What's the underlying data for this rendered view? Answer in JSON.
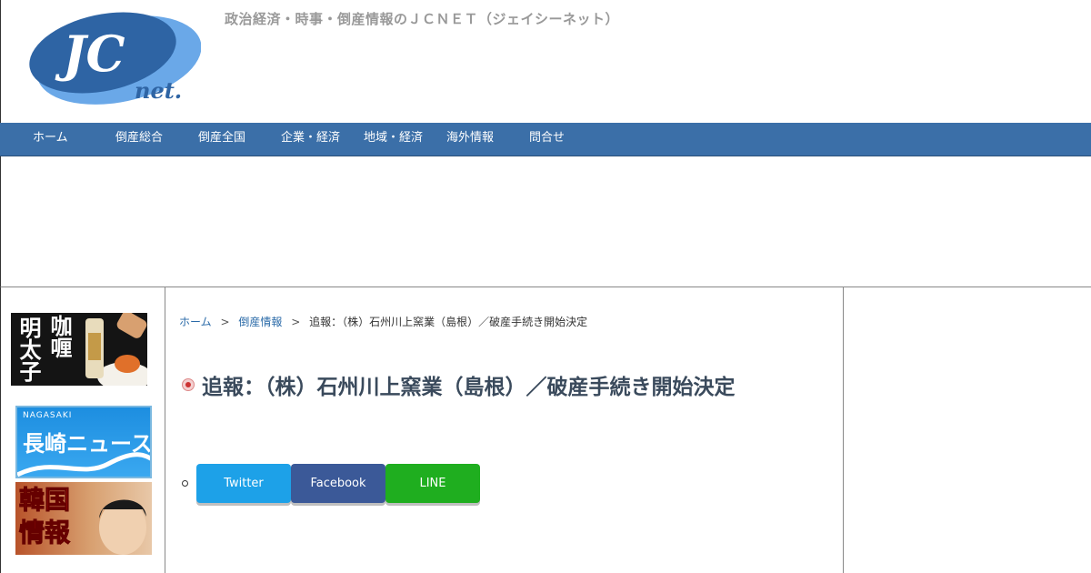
{
  "header": {
    "logo_text_main": "JC",
    "logo_text_sub": "net.",
    "tagline": "政治経済・時事・倒産情報のＪＣＮＥＴ（ジェイシーネット）"
  },
  "nav": {
    "items": [
      {
        "label": "ホーム"
      },
      {
        "label": "倒産総合"
      },
      {
        "label": "倒産全国"
      },
      {
        "label": "企業・経済"
      },
      {
        "label": "地域・経済"
      },
      {
        "label": "海外情報"
      },
      {
        "label": "問合せ"
      }
    ]
  },
  "sidebar": {
    "banner_curry": {
      "line1": "咖喱",
      "line2": "明太子"
    },
    "banner_nagasaki": {
      "small": "NAGASAKI",
      "big": "長崎ニュース"
    },
    "banner_korea": {
      "text": "韓国情報"
    }
  },
  "breadcrumb": {
    "home": "ホーム",
    "separator": ">",
    "category": "倒産情報",
    "current": "追報：（株）石州川上窯業（島根）／破産手続き開始決定"
  },
  "article": {
    "title": "追報：（株）石州川上窯業（島根）／破産手続き開始決定",
    "share": {
      "twitter": "Twitter",
      "facebook": "Facebook",
      "line": "LINE"
    }
  },
  "colors": {
    "nav_bg": "#3b6fa8",
    "twitter": "#1da1e8",
    "facebook": "#3b5998",
    "line": "#1fae1f",
    "link": "#2a6aa8"
  }
}
